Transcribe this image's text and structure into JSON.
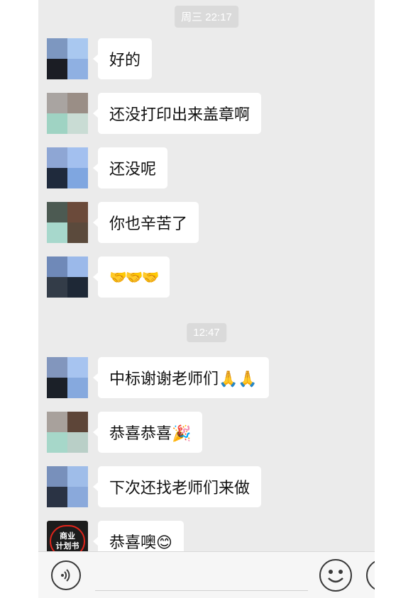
{
  "timestamps": [
    "周三 22:17",
    "12:47"
  ],
  "messages": [
    {
      "text": "好的",
      "avatar": "avatar-1"
    },
    {
      "text": "还没打印出来盖章啊",
      "avatar": "avatar-2"
    },
    {
      "text": "还没呢",
      "avatar": "avatar-1"
    },
    {
      "text": "你也辛苦了",
      "avatar": "avatar-3"
    },
    {
      "text": "🤝🤝🤝",
      "avatar": "avatar-1"
    },
    {
      "text": "中标谢谢老师们🙏🙏",
      "avatar": "avatar-1"
    },
    {
      "text": "恭喜恭喜🎉",
      "avatar": "avatar-2"
    },
    {
      "text": "下次还找老师们来做",
      "avatar": "avatar-1"
    },
    {
      "text": "恭喜噢😊",
      "avatar": "avatar-badge"
    }
  ],
  "badge_avatar": {
    "line1": "商业",
    "line2": "计划书"
  },
  "toolbar": {
    "voice_icon": "voice-icon",
    "emoji_icon": "emoji-smile-icon",
    "plus_icon": "plus-icon"
  },
  "colors": {
    "chat_bg": "#ebebeb",
    "bubble": "#ffffff",
    "timestamp_bg": "#dadada",
    "toolbar_bg": "#f6f6f6"
  }
}
